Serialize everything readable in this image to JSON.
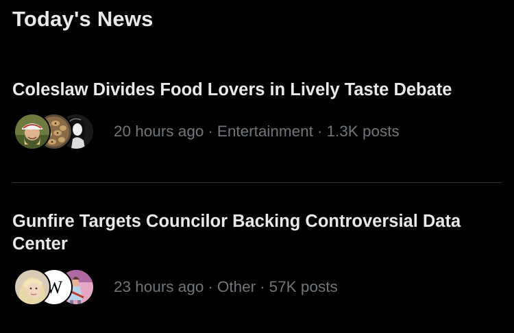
{
  "section": {
    "title": "Today's News"
  },
  "stories": [
    {
      "headline": "Coleslaw Divides Food Lovers in Lively Taste Debate",
      "time": "20 hours ago",
      "category": "Entertainment",
      "posts": "1.3K posts",
      "separator": "·"
    },
    {
      "headline": "Gunfire Targets Councilor Backing Controversial Data Center",
      "time": "23 hours ago",
      "category": "Other",
      "posts": "57K posts",
      "separator": "·",
      "avatar_letter": "W"
    }
  ],
  "colors": {
    "background": "#000000",
    "text_primary": "#e7e9ea",
    "text_secondary": "#71767b",
    "divider": "#2f3336"
  }
}
